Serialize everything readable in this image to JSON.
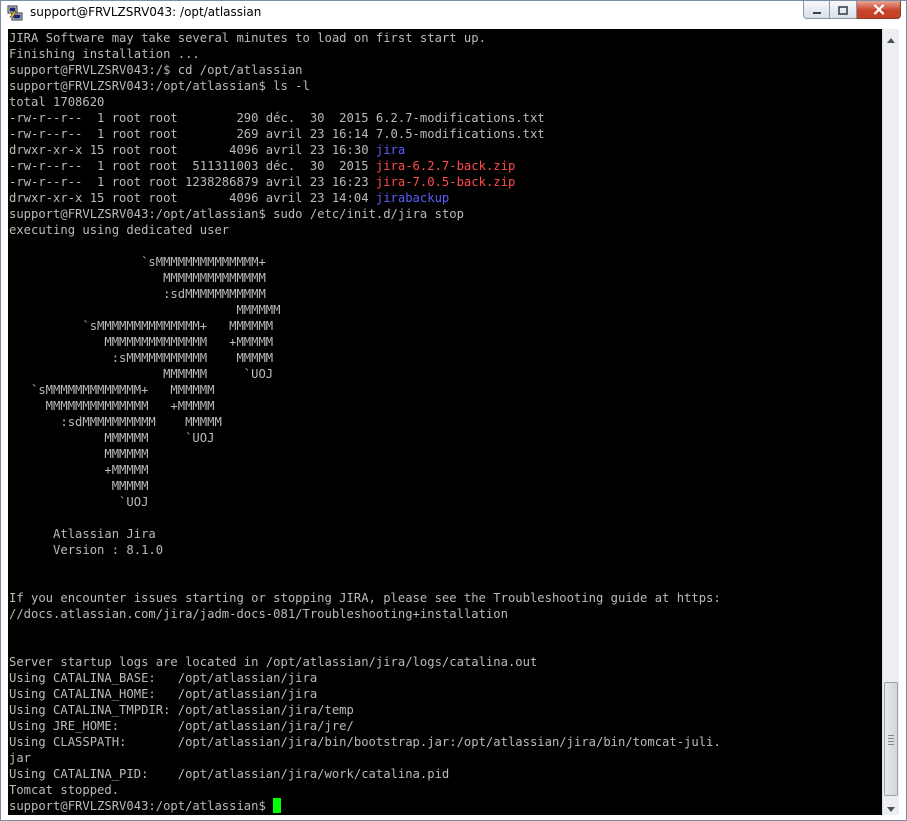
{
  "window": {
    "title": "support@FRVLZSRV043: /opt/atlassian"
  },
  "icons": {
    "app": "putty-icon",
    "minimize": "minimize-icon",
    "maximize": "maximize-icon",
    "close": "close-icon",
    "scroll_up": "arrow-up-icon",
    "scroll_down": "arrow-down-icon"
  },
  "colors": {
    "terminal_bg": "#000000",
    "terminal_fg": "#bbbbbb",
    "directory": "#5c5cff",
    "archive": "#ff4b4b",
    "cursor": "#00ff00"
  },
  "terminal": {
    "lines": [
      [
        {
          "t": "JIRA Software may take several minutes to load on first start up."
        }
      ],
      [
        {
          "t": "Finishing installation ..."
        }
      ],
      [
        {
          "t": "support@FRVLZSRV043:/$ cd /opt/atlassian"
        }
      ],
      [
        {
          "t": "support@FRVLZSRV043:/opt/atlassian$ ls -l"
        }
      ],
      [
        {
          "t": "total 1708620"
        }
      ],
      [
        {
          "t": "-rw-r--r--  1 root root        290 déc.  30  2015 6.2.7-modifications.txt"
        }
      ],
      [
        {
          "t": "-rw-r--r--  1 root root        269 avril 23 16:14 7.0.5-modifications.txt"
        }
      ],
      [
        {
          "t": "drwxr-xr-x 15 root root       4096 avril 23 16:30 "
        },
        {
          "t": "jira",
          "c": "blue"
        }
      ],
      [
        {
          "t": "-rw-r--r--  1 root root  511311003 déc.  30  2015 "
        },
        {
          "t": "jira-6.2.7-back.zip",
          "c": "red"
        }
      ],
      [
        {
          "t": "-rw-r--r--  1 root root 1238286879 avril 23 16:23 "
        },
        {
          "t": "jira-7.0.5-back.zip",
          "c": "red"
        }
      ],
      [
        {
          "t": "drwxr-xr-x 15 root root       4096 avril 23 14:04 "
        },
        {
          "t": "jirabackup",
          "c": "blue"
        }
      ],
      [
        {
          "t": "support@FRVLZSRV043:/opt/atlassian$ sudo /etc/init.d/jira stop"
        }
      ],
      [
        {
          "t": "executing using dedicated user"
        }
      ],
      [
        {
          "t": ""
        }
      ],
      [
        {
          "t": "                  `sMMMMMMMMMMMMMM+"
        }
      ],
      [
        {
          "t": "                     MMMMMMMMMMMMMM"
        }
      ],
      [
        {
          "t": "                     :sdMMMMMMMMMMM"
        }
      ],
      [
        {
          "t": "                               MMMMMM"
        }
      ],
      [
        {
          "t": "          `sMMMMMMMMMMMMMM+   MMMMMM"
        }
      ],
      [
        {
          "t": "             MMMMMMMMMMMMMM   +MMMMM"
        }
      ],
      [
        {
          "t": "              :sMMMMMMMMMMM    MMMMM"
        }
      ],
      [
        {
          "t": "                     MMMMMM     `UOJ"
        }
      ],
      [
        {
          "t": "   `sMMMMMMMMMMMMM+   MMMMMM"
        }
      ],
      [
        {
          "t": "     MMMMMMMMMMMMMM   +MMMMM"
        }
      ],
      [
        {
          "t": "       :sdMMMMMMMMMM    MMMMM"
        }
      ],
      [
        {
          "t": "             MMMMMM     `UOJ"
        }
      ],
      [
        {
          "t": "             MMMMMM"
        }
      ],
      [
        {
          "t": "             +MMMMM"
        }
      ],
      [
        {
          "t": "              MMMMM"
        }
      ],
      [
        {
          "t": "               `UOJ"
        }
      ],
      [
        {
          "t": ""
        }
      ],
      [
        {
          "t": "      Atlassian Jira"
        }
      ],
      [
        {
          "t": "      Version : 8.1.0"
        }
      ],
      [
        {
          "t": ""
        }
      ],
      [
        {
          "t": ""
        }
      ],
      [
        {
          "t": "If you encounter issues starting or stopping JIRA, please see the Troubleshooting guide at https:"
        }
      ],
      [
        {
          "t": "//docs.atlassian.com/jira/jadm-docs-081/Troubleshooting+installation"
        }
      ],
      [
        {
          "t": ""
        }
      ],
      [
        {
          "t": ""
        }
      ],
      [
        {
          "t": "Server startup logs are located in /opt/atlassian/jira/logs/catalina.out"
        }
      ],
      [
        {
          "t": "Using CATALINA_BASE:   /opt/atlassian/jira"
        }
      ],
      [
        {
          "t": "Using CATALINA_HOME:   /opt/atlassian/jira"
        }
      ],
      [
        {
          "t": "Using CATALINA_TMPDIR: /opt/atlassian/jira/temp"
        }
      ],
      [
        {
          "t": "Using JRE_HOME:        /opt/atlassian/jira/jre/"
        }
      ],
      [
        {
          "t": "Using CLASSPATH:       /opt/atlassian/jira/bin/bootstrap.jar:/opt/atlassian/jira/bin/tomcat-juli."
        }
      ],
      [
        {
          "t": "jar"
        }
      ],
      [
        {
          "t": "Using CATALINA_PID:    /opt/atlassian/jira/work/catalina.pid"
        }
      ],
      [
        {
          "t": "Tomcat stopped."
        }
      ],
      [
        {
          "t": "support@FRVLZSRV043:/opt/atlassian$ "
        },
        {
          "cursor": true
        }
      ]
    ]
  }
}
